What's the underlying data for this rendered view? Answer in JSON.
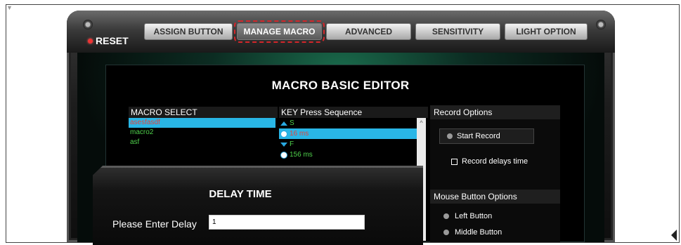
{
  "toolbar": {
    "reset_label": "RESET",
    "tabs": [
      {
        "label": "ASSIGN BUTTON"
      },
      {
        "label": "MANAGE MACRO"
      },
      {
        "label": "ADVANCED"
      },
      {
        "label": "SENSITIVITY"
      },
      {
        "label": "LIGHT OPTION"
      }
    ]
  },
  "editor": {
    "title": "MACRO BASIC EDITOR",
    "macro_select": {
      "header": "MACRO SELECT",
      "items": [
        {
          "label": "asesfasdf",
          "color": "#e2453c"
        },
        {
          "label": "macro2",
          "color": "#4fd14b"
        },
        {
          "label": "asf",
          "color": "#4fd14b"
        }
      ]
    },
    "key_sequence": {
      "header": "KEY Press Sequence",
      "items": [
        {
          "type": "up",
          "text": "S",
          "color": "#4fd14b"
        },
        {
          "type": "delay",
          "text": "16 ms",
          "color": "#e2453c"
        },
        {
          "type": "down",
          "text": "F",
          "color": "#4fd14b"
        },
        {
          "type": "delay",
          "text": "156 ms",
          "color": "#4fd14b"
        }
      ]
    }
  },
  "record_options": {
    "header": "Record Options",
    "start_record": "Start Record",
    "record_delays": "Record delays time"
  },
  "mouse_button_options": {
    "header": "Mouse Button Options",
    "left": "Left Button",
    "middle": "Middle Button"
  },
  "delay_dialog": {
    "title": "DELAY TIME",
    "label": "Please Enter Delay",
    "value": "1"
  },
  "colors": {
    "selection": "#29b6e6",
    "highlight_outline": "#d4262a"
  }
}
